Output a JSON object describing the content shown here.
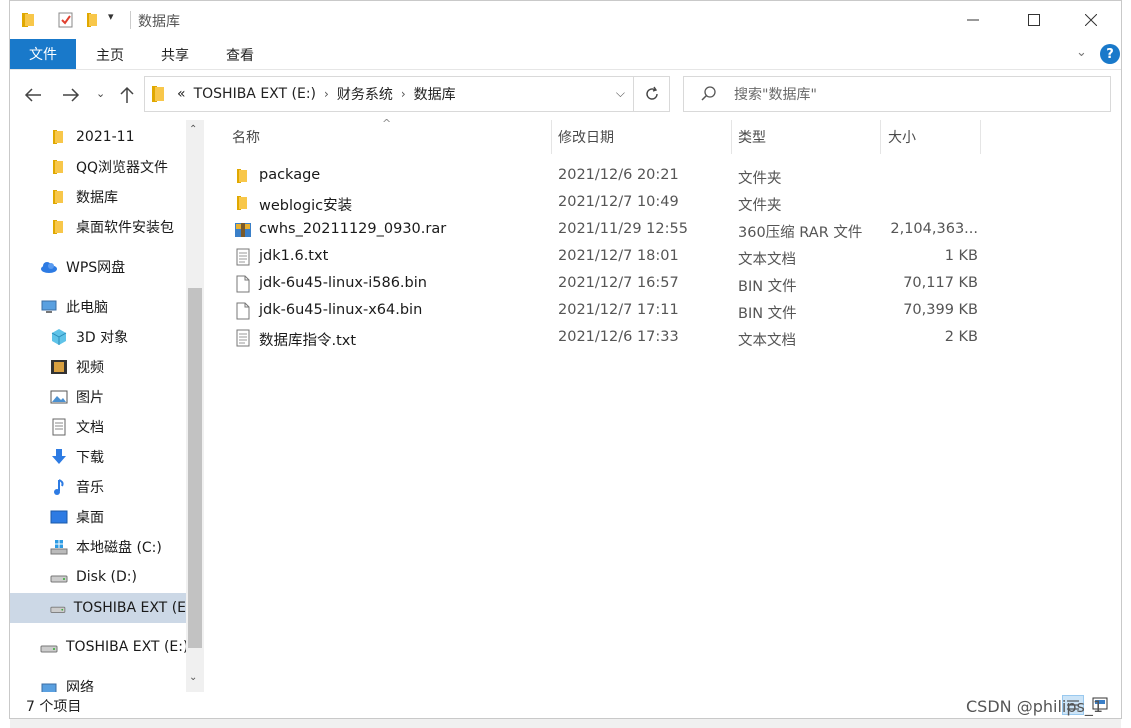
{
  "window": {
    "title": "数据库"
  },
  "ribbon": {
    "file": "文件",
    "home": "主页",
    "share": "共享",
    "view": "查看",
    "help": "?"
  },
  "address": {
    "overflow": "«",
    "crumbs": [
      "TOSHIBA EXT (E:)",
      "财务系统",
      "数据库"
    ]
  },
  "search": {
    "placeholder": "搜索\"数据库\""
  },
  "sidebar": {
    "items": [
      {
        "label": "2021-11",
        "icon": "folder-icon"
      },
      {
        "label": "QQ浏览器文件",
        "icon": "folder-icon"
      },
      {
        "label": "数据库",
        "icon": "folder-icon"
      },
      {
        "label": "桌面软件安装包",
        "icon": "folder-icon"
      },
      {
        "label": "WPS网盘",
        "icon": "cloud-icon"
      },
      {
        "label": "此电脑",
        "icon": "computer-icon"
      },
      {
        "label": "3D 对象",
        "icon": "cube-icon"
      },
      {
        "label": "视频",
        "icon": "video-icon"
      },
      {
        "label": "图片",
        "icon": "picture-icon"
      },
      {
        "label": "文档",
        "icon": "document-icon"
      },
      {
        "label": "下载",
        "icon": "download-icon"
      },
      {
        "label": "音乐",
        "icon": "music-icon"
      },
      {
        "label": "桌面",
        "icon": "desktop-icon"
      },
      {
        "label": "本地磁盘 (C:)",
        "icon": "windows-drive-icon"
      },
      {
        "label": "Disk (D:)",
        "icon": "drive-icon"
      },
      {
        "label": "TOSHIBA EXT (E",
        "icon": "drive-icon"
      },
      {
        "label": "TOSHIBA EXT (E:)",
        "icon": "drive-icon"
      },
      {
        "label": "网络",
        "icon": "network-icon"
      }
    ]
  },
  "columns": {
    "name": "名称",
    "date": "修改日期",
    "type": "类型",
    "size": "大小"
  },
  "files": [
    {
      "name": "package",
      "date": "2021/12/6 20:21",
      "type": "文件夹",
      "size": "",
      "icon": "folder-icon"
    },
    {
      "name": "weblogic安装",
      "date": "2021/12/7 10:49",
      "type": "文件夹",
      "size": "",
      "icon": "folder-icon"
    },
    {
      "name": "cwhs_20211129_0930.rar",
      "date": "2021/11/29 12:55",
      "type": "360压缩 RAR 文件",
      "size": "2,104,363...",
      "icon": "archive-icon"
    },
    {
      "name": "jdk1.6.txt",
      "date": "2021/12/7 18:01",
      "type": "文本文档",
      "size": "1 KB",
      "icon": "text-file-icon"
    },
    {
      "name": "jdk-6u45-linux-i586.bin",
      "date": "2021/12/7 16:57",
      "type": "BIN 文件",
      "size": "70,117 KB",
      "icon": "file-icon"
    },
    {
      "name": "jdk-6u45-linux-x64.bin",
      "date": "2021/12/7 17:11",
      "type": "BIN 文件",
      "size": "70,399 KB",
      "icon": "file-icon"
    },
    {
      "name": "数据库指令.txt",
      "date": "2021/12/6 17:33",
      "type": "文本文档",
      "size": "2 KB",
      "icon": "text-file-icon"
    }
  ],
  "status": {
    "count": "7 个项目"
  },
  "watermark": "CSDN @philips_1",
  "colors": {
    "accent": "#1979ca",
    "folder": "#f8c74a",
    "selected": "#ccd8e6"
  }
}
